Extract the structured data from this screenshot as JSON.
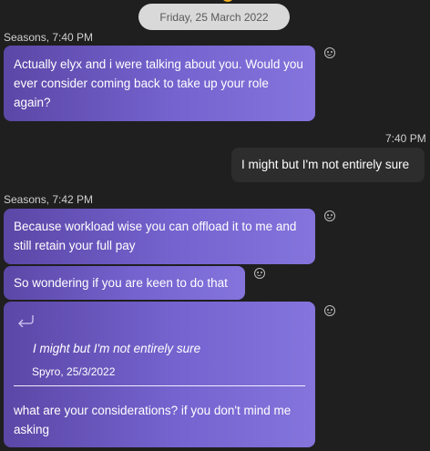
{
  "date_separator": "Friday, 25 March 2022",
  "groups": [
    {
      "sender_time": "Seasons, 7:40 PM"
    },
    {
      "sender_time": "7:40 PM"
    },
    {
      "sender_time": "Seasons, 7:42 PM"
    }
  ],
  "messages": [
    {
      "text": "Actually elyx and i were talking about you. Would you ever consider coming back to take up your role again?"
    },
    {
      "text": "I might but I'm not entirely sure"
    },
    {
      "text": "Because workload wise you can offload it to me and still retain your full pay"
    },
    {
      "text": "So wondering if you are keen to do that"
    },
    {
      "quote": {
        "text": "I might but I'm not entirely sure",
        "attribution": "Spyro, 25/3/2022"
      },
      "text": "what are your considerations? if you don't mind me asking"
    }
  ],
  "icons": {
    "reaction": "smiley-reaction-icon",
    "reply": "reply-arrow-icon"
  }
}
